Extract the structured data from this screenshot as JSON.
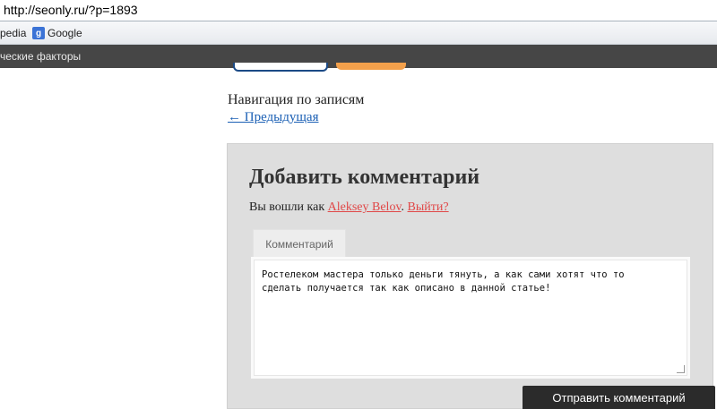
{
  "browser": {
    "url": "http://seonly.ru/?p=1893",
    "bookmarks": [
      {
        "label": "pedia"
      },
      {
        "label": "Google",
        "icon": "google-g-icon"
      }
    ]
  },
  "admin_bar": {
    "text": "ческие факторы"
  },
  "post_navigation": {
    "title": "Навигация по записям",
    "prev_link": "← Предыдущая"
  },
  "comment_form": {
    "title": "Добавить комментарий",
    "logged_in_prefix": "Вы вошли как ",
    "user_name": "Aleksey Belov",
    "separator": ". ",
    "logout_link": "Выйти?",
    "tab_label": "Комментарий",
    "comment_text": "Ростелеком мастера только деньги тянуть, а как сами хотят что то\nсделать получается так как описано в данной статье!",
    "submit_label": "Отправить комментарий"
  },
  "colors": {
    "admin_bar": "#464646",
    "link": "#1a5fb4",
    "user_link": "#e04848",
    "form_bg": "#dedede",
    "submit_bg": "#2b2b2b"
  }
}
